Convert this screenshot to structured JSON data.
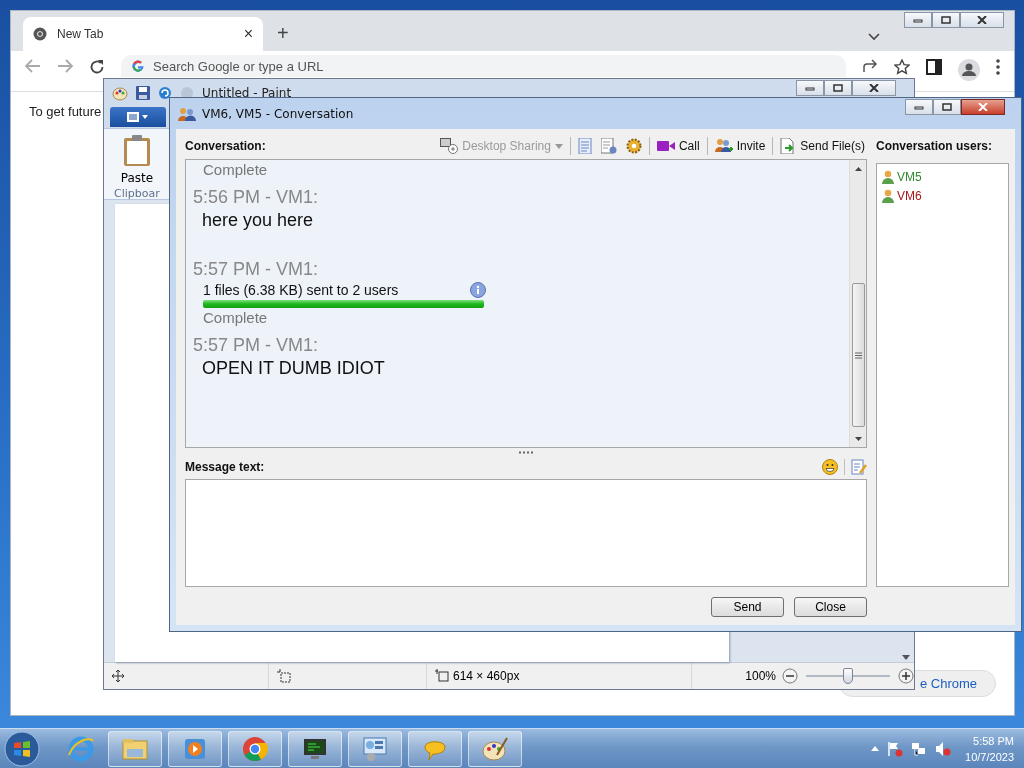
{
  "browser": {
    "tab": {
      "title": "New Tab",
      "close": "×"
    },
    "new_tab": "+",
    "omnibox": {
      "placeholder": "Search Google or type a URL"
    },
    "page_text": "To get future",
    "customize_chip": "e Chrome"
  },
  "paint": {
    "title": "Untitled - Paint",
    "paste": "Paste",
    "group": "Clipboar",
    "status": {
      "size": "614 × 460px",
      "zoom": "100%",
      "level": 0.5
    }
  },
  "conversation": {
    "title": "VM6, VM5 - Conversation",
    "label": "Conversation:",
    "toolbar": [
      {
        "kind": "sharing",
        "label": "Desktop Sharing",
        "disabled": true
      },
      {
        "kind": "notes"
      },
      {
        "kind": "document"
      },
      {
        "kind": "gear"
      },
      {
        "kind": "call",
        "label": "Call",
        "disabled": false
      },
      {
        "kind": "invite",
        "label": "Invite",
        "disabled": false
      },
      {
        "kind": "send",
        "label": "Send File(s)",
        "disabled": false
      }
    ],
    "messages": [
      {
        "kind": "status",
        "text": "Complete"
      },
      {
        "kind": "message",
        "header": "5:56 PM - VM1:",
        "text": "here you here"
      },
      {
        "kind": "transfer",
        "header": "5:57 PM - VM1:",
        "text": "1 files (6.38 KB) sent to 2 users",
        "level": 1,
        "status": "Complete"
      },
      {
        "kind": "message",
        "header": "5:57 PM - VM1:",
        "text": "OPEN IT DUMB IDIOT"
      }
    ],
    "users_label": "Conversation users:",
    "users": [
      {
        "name": "VM5",
        "color": "#2f8a2f"
      },
      {
        "name": "VM6",
        "color": "#a81818"
      }
    ],
    "message_label": "Message text:",
    "buttons": [
      "Send",
      "Close"
    ]
  },
  "taskbar": {
    "clock": {
      "time": "5:58 PM",
      "date": "10/7/2023"
    }
  }
}
